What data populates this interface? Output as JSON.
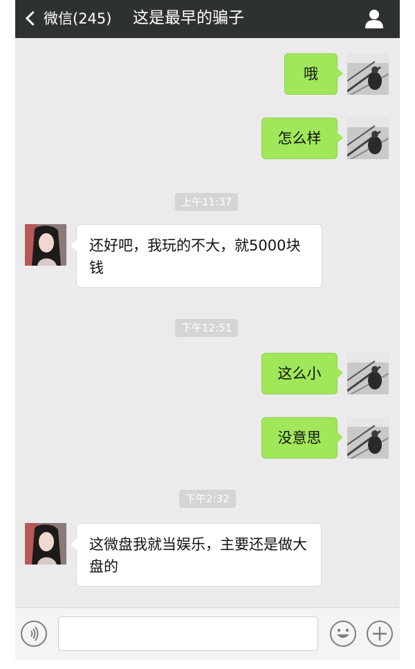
{
  "header": {
    "back_label": "微信(245)",
    "title": "这是最早的骗子"
  },
  "messages": [
    {
      "type": "sent",
      "text": "哦"
    },
    {
      "type": "sent",
      "text": "怎么样"
    },
    {
      "type": "time",
      "text": "上午11:37"
    },
    {
      "type": "received",
      "text": "还好吧，我玩的不大，就5000块钱"
    },
    {
      "type": "time",
      "text": "下午12:51"
    },
    {
      "type": "sent",
      "text": "这么小"
    },
    {
      "type": "sent",
      "text": "没意思"
    },
    {
      "type": "time",
      "text": "下午2:32"
    },
    {
      "type": "received",
      "text": "这微盘我就当娱乐，主要还是做大盘的"
    }
  ],
  "input": {
    "value": "",
    "placeholder": ""
  },
  "icons": {
    "back": "chevron-left-icon",
    "profile": "person-icon",
    "voice": "voice-icon",
    "emoji": "emoji-icon",
    "more": "plus-icon"
  },
  "colors": {
    "header_bg": "#2e3132",
    "chat_bg": "#ebebeb",
    "sent_bubble": "#a0e75a",
    "received_bubble": "#ffffff",
    "time_badge": "#d5d5d5"
  }
}
